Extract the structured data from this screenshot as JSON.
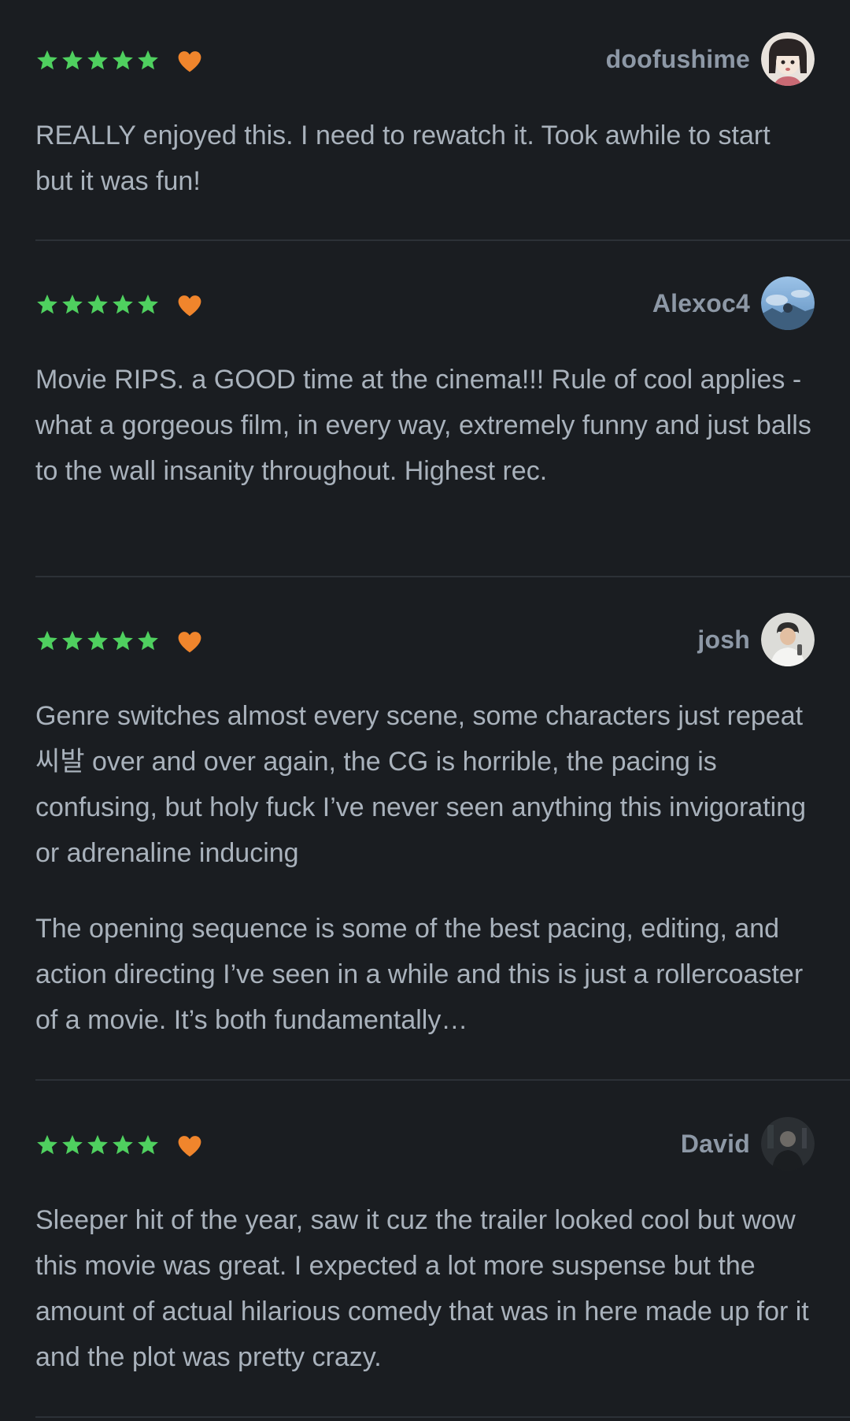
{
  "colors": {
    "background": "#1a1d21",
    "star": "#4fd05f",
    "heart": "#f0852c",
    "username": "#8d98a6",
    "text": "#a9b2bc",
    "divider": "#2c3137"
  },
  "reviews": [
    {
      "username": "doofushime",
      "rating": 5,
      "liked": true,
      "avatar_icon": "cartoon-girl-avatar",
      "paragraphs": [
        "REALLY enjoyed this. I need to rewatch it. Took awhile to start but it was fun!"
      ]
    },
    {
      "username": "Alexoc4",
      "rating": 5,
      "liked": true,
      "avatar_icon": "blue-sky-photo-avatar",
      "paragraphs": [
        "Movie RIPS. a GOOD time at the cinema!!! Rule of cool applies - what a gorgeous film, in every way, extremely funny and just balls to the wall insanity throughout. Highest rec."
      ]
    },
    {
      "username": "josh",
      "rating": 5,
      "liked": true,
      "avatar_icon": "person-photo-avatar",
      "paragraphs": [
        "Genre switches almost every scene, some characters just repeat 씨발 over and over again, the CG is horrible, the pacing is confusing, but holy fuck I’ve never seen anything this invigorating or adrenaline inducing",
        "The opening sequence is some of the best pacing, editing, and action directing I’ve seen in a while and this is just a rollercoaster of a movie. It’s both fundamentally…"
      ]
    },
    {
      "username": "David",
      "rating": 5,
      "liked": true,
      "avatar_icon": "dark-photo-avatar",
      "paragraphs": [
        "Sleeper hit of the year, saw it cuz the trailer looked cool but wow this movie was great. I expected a lot more suspense but the amount of actual hilarious comedy that was in here made up for it and the plot was pretty crazy."
      ]
    }
  ]
}
